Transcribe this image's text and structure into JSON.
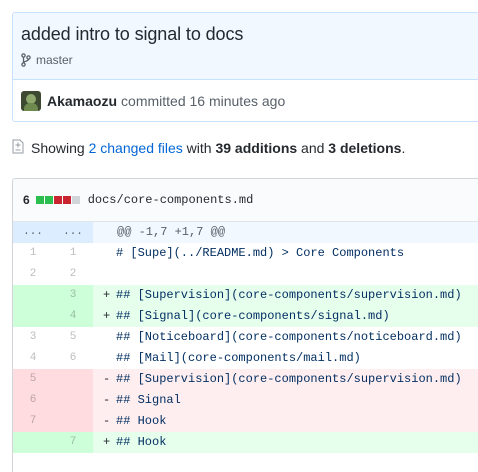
{
  "commit": {
    "title": "added intro to signal to docs",
    "branch_icon": "git-branch-icon",
    "branch": "master",
    "author": "Akamaozu",
    "action": "committed",
    "time": "16 minutes ago"
  },
  "summary": {
    "icon": "file-diff-icon",
    "showing": "Showing",
    "changed_files": "2 changed files",
    "with": "with",
    "additions": "39 additions",
    "and": "and",
    "deletions": "3 deletions",
    "period": "."
  },
  "file": {
    "change_count": "6",
    "diffstat": [
      "add",
      "add",
      "del",
      "del",
      "neu"
    ],
    "path": "docs/core-components.md",
    "hunk": {
      "left": "...",
      "right": "...",
      "header": "@@ -1,7 +1,7 @@"
    },
    "lines": [
      {
        "type": "ctx",
        "old": "1",
        "new": "1",
        "marker": "",
        "text": "# [Supe](../README.md) > Core Components"
      },
      {
        "type": "ctx",
        "old": "2",
        "new": "2",
        "marker": "",
        "text": ""
      },
      {
        "type": "add",
        "old": "",
        "new": "3",
        "marker": "+",
        "text": "## [Supervision](core-components/supervision.md)"
      },
      {
        "type": "add",
        "old": "",
        "new": "4",
        "marker": "+",
        "text": "## [Signal](core-components/signal.md)"
      },
      {
        "type": "ctx",
        "old": "3",
        "new": "5",
        "marker": "",
        "text": "## [Noticeboard](core-components/noticeboard.md)"
      },
      {
        "type": "ctx",
        "old": "4",
        "new": "6",
        "marker": "",
        "text": "## [Mail](core-components/mail.md)"
      },
      {
        "type": "del",
        "old": "5",
        "new": "",
        "marker": "-",
        "text": "## [Supervision](core-components/supervision.md)"
      },
      {
        "type": "del",
        "old": "6",
        "new": "",
        "marker": "-",
        "text": "## Signal"
      },
      {
        "type": "del",
        "old": "7",
        "new": "",
        "marker": "-",
        "text": "## Hook"
      },
      {
        "type": "add",
        "old": "",
        "new": "7",
        "marker": "+",
        "text": "## Hook"
      }
    ]
  },
  "colors": {
    "link": "#0366d6",
    "addition_bg": "#e6ffed",
    "deletion_bg": "#ffeef0",
    "hunk_bg": "#f1f8ff"
  }
}
